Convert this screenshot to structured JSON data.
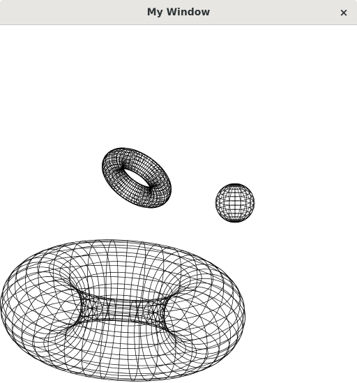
{
  "window": {
    "title": "My Window",
    "close_glyph": "×",
    "close_icon": "close-icon"
  },
  "scene": {
    "background_color": "#ffffff",
    "wire_color": "#000000",
    "objects": [
      {
        "name": "small-torus",
        "kind": "torus",
        "icon": "torus-wireframe"
      },
      {
        "name": "sphere",
        "kind": "sphere",
        "icon": "sphere-wireframe"
      },
      {
        "name": "large-torus",
        "kind": "torus",
        "icon": "torus-wireframe"
      }
    ]
  }
}
